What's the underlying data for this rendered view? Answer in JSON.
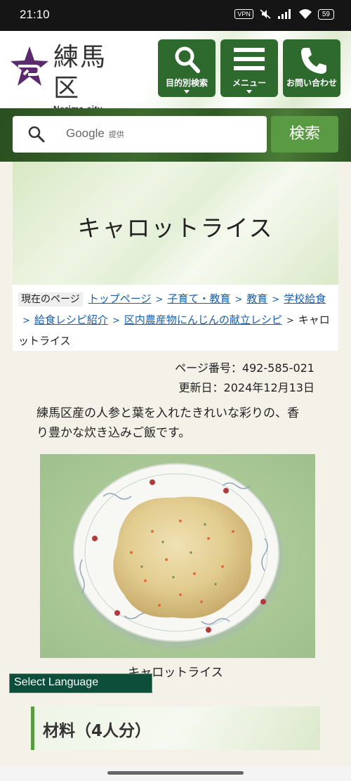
{
  "status_bar": {
    "time": "21:10",
    "vpn": "VPN",
    "battery": "59"
  },
  "header": {
    "logo_name": "練馬区",
    "logo_sub": "Nerima city office",
    "buttons": [
      {
        "label": "目的別検索",
        "icon": "search-icon"
      },
      {
        "label": "メニュー",
        "icon": "menu-icon"
      },
      {
        "label": "お問い合わせ",
        "icon": "phone-icon"
      }
    ]
  },
  "search": {
    "placeholder_brand": "Google",
    "placeholder_suffix": "提供",
    "button": "検索"
  },
  "page": {
    "title": "キャロットライス",
    "breadcrumb": {
      "here_label": "現在のページ",
      "links": [
        "トップページ",
        "子育て・教育",
        "教育",
        "学校給食",
        "給食レシピ紹介",
        "区内農産物にんじんの献立レシピ"
      ],
      "current": "キャロットライス"
    },
    "page_number": "ページ番号：492-585-021",
    "updated": "更新日：2024年12月13日",
    "description": "練馬区産の人参と葉を入れたきれいな彩りの、香り豊かな炊き込みご飯です。",
    "photo_caption": "キャロットライス",
    "section_heading": "材料（4人分）"
  },
  "language_select": "Select Language",
  "colors": {
    "brand_green": "#2e6a2e",
    "search_button": "#5a9a42",
    "link": "#1a5ea8",
    "brand_purple": "#5b2a6e"
  }
}
